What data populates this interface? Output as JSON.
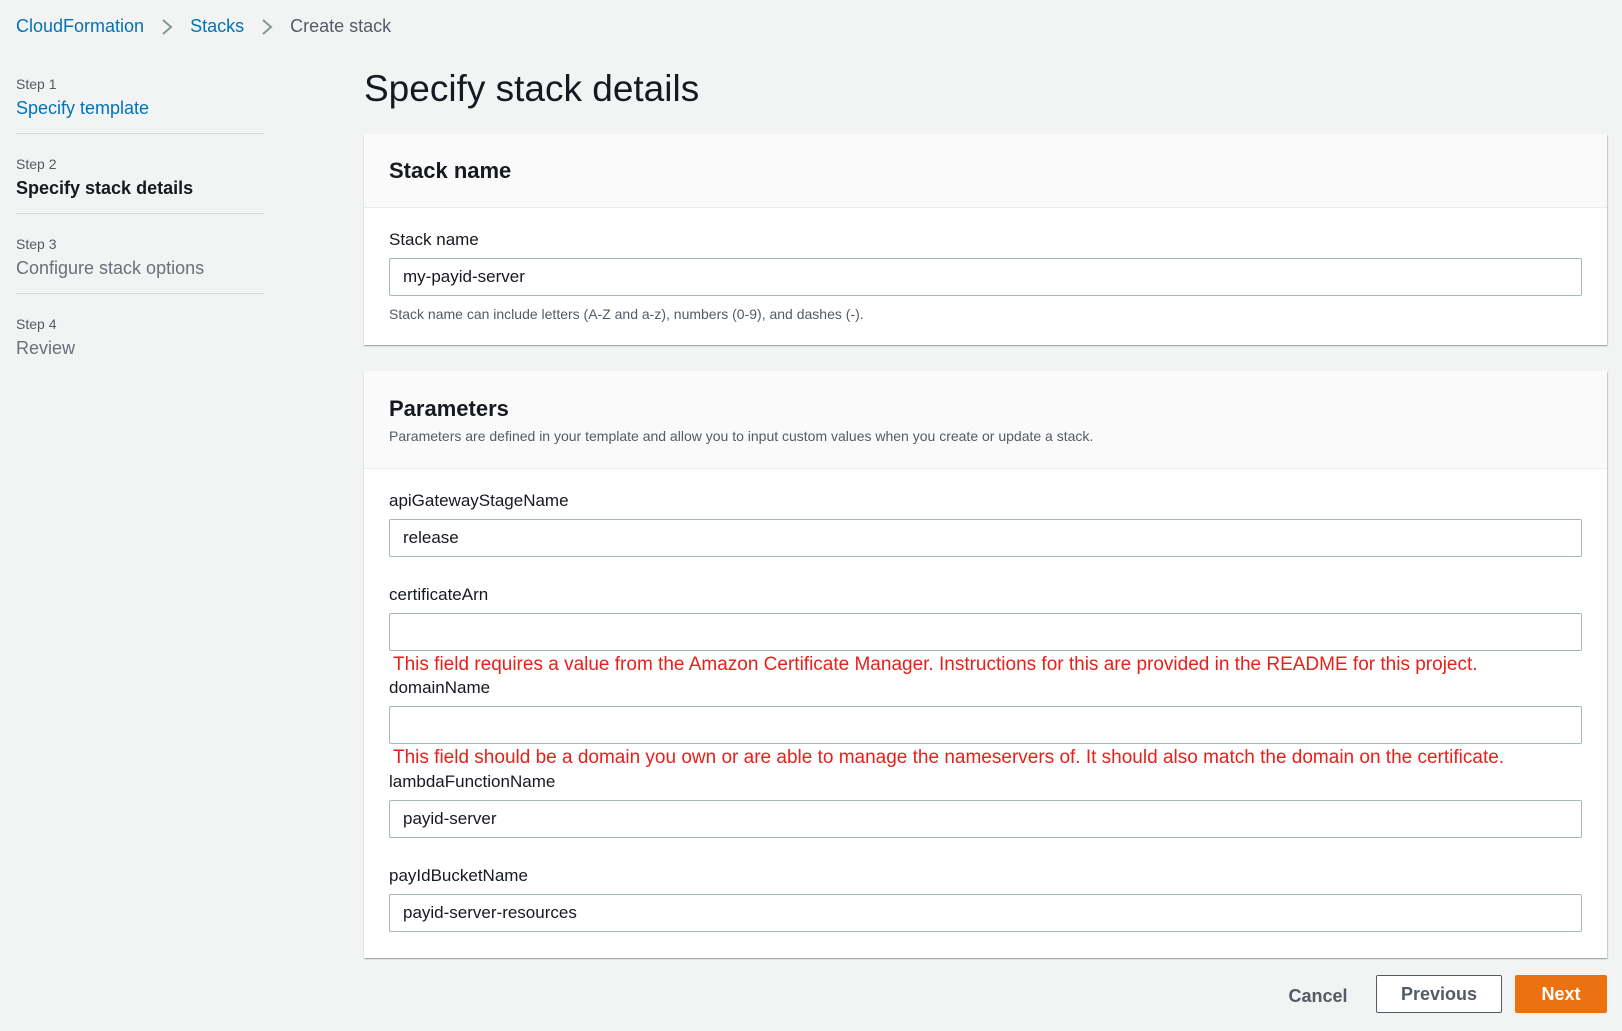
{
  "breadcrumb": {
    "items": [
      {
        "label": "CloudFormation"
      },
      {
        "label": "Stacks"
      },
      {
        "label": "Create stack"
      }
    ]
  },
  "steps": [
    {
      "number": "Step 1",
      "title": "Specify template",
      "state": "link"
    },
    {
      "number": "Step 2",
      "title": "Specify stack details",
      "state": "active"
    },
    {
      "number": "Step 3",
      "title": "Configure stack options",
      "state": "disabled"
    },
    {
      "number": "Step 4",
      "title": "Review",
      "state": "disabled"
    }
  ],
  "page": {
    "title": "Specify stack details"
  },
  "stack_name_panel": {
    "header": "Stack name",
    "field_label": "Stack name",
    "value": "my-payid-server",
    "hint": "Stack name can include letters (A-Z and a-z), numbers (0-9), and dashes (-)."
  },
  "parameters_panel": {
    "header": "Parameters",
    "description": "Parameters are defined in your template and allow you to input custom values when you create or update a stack.",
    "fields": [
      {
        "label": "apiGatewayStageName",
        "value": "release"
      },
      {
        "label": "certificateArn",
        "value": "",
        "note": "This field requires a value from the Amazon Certificate Manager. Instructions for this are provided in the README for this project."
      },
      {
        "label": "domainName",
        "value": "",
        "note": "This field should be a domain you own or are able to manage the nameservers of. It should also match the domain on the certificate."
      },
      {
        "label": "lambdaFunctionName",
        "value": "payid-server"
      },
      {
        "label": "payIdBucketName",
        "value": "payid-server-resources"
      }
    ]
  },
  "actions": {
    "cancel": "Cancel",
    "previous": "Previous",
    "next": "Next"
  },
  "colors": {
    "link": "#0073bb",
    "primary_button": "#ec7211",
    "error_note": "#e8201c",
    "background": "#f2f3f3"
  }
}
